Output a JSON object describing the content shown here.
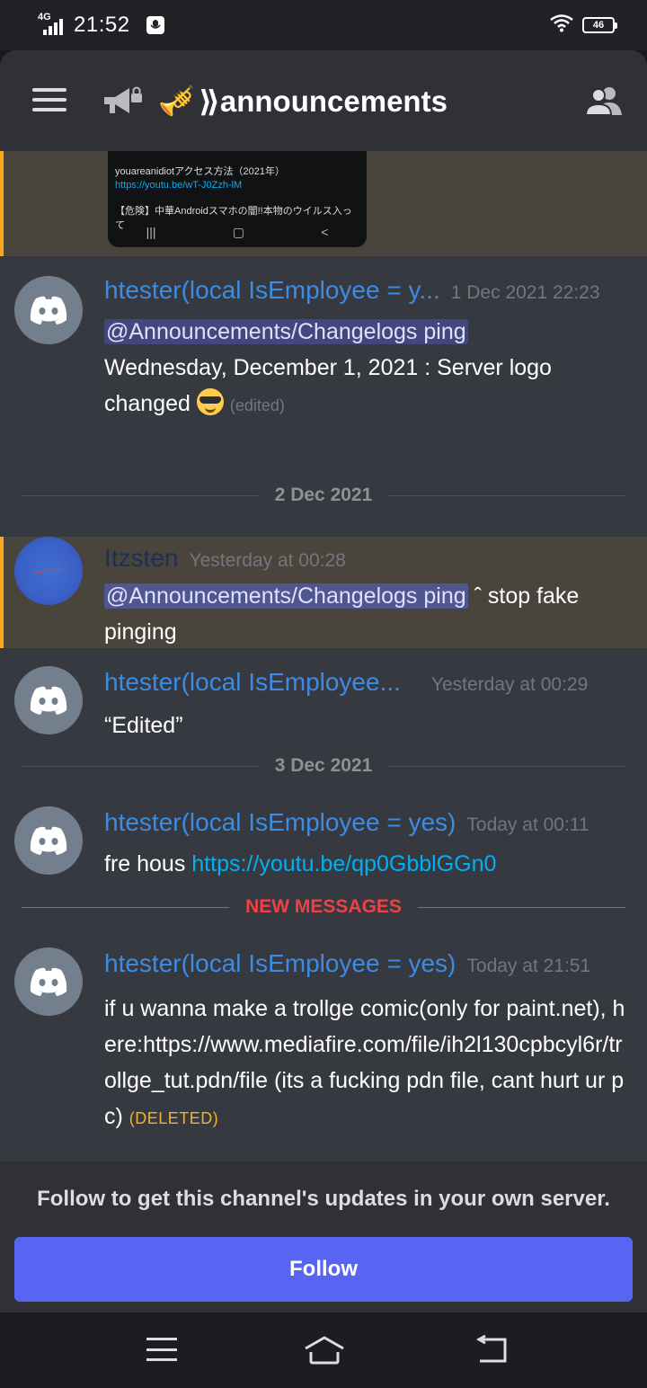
{
  "status_bar": {
    "network": "4G",
    "time": "21:52",
    "battery": "46"
  },
  "header": {
    "channel_emoji": "🎺",
    "channel_name": "⟫announcements"
  },
  "embed": {
    "line1": "youareanidiotアクセス方法（2021年）",
    "line2": "https://youtu.be/wT-J0Zzh-lM",
    "line3": "【危険】中華Androidスマホの闇!!本物のウイルス入って",
    "nav": [
      "|||",
      "▢",
      "<"
    ]
  },
  "messages": [
    {
      "author": "htester(local IsEmployee = y...",
      "timestamp": "1 Dec 2021 22:23",
      "mention": "@Announcements/Changelogs ping",
      "text": " Wednesday, December 1, 2021 : Server logo changed ",
      "edited": "(edited)"
    },
    {
      "author": "Itzsten",
      "timestamp": "Yesterday at 00:28",
      "mention": "@Announcements/Changelogs ping",
      "text": " ˆ stop fake pinging"
    },
    {
      "author": "htester(local IsEmployee...",
      "timestamp": "Yesterday at 00:29",
      "text": "“Edited”"
    },
    {
      "author": "htester(local IsEmployee = yes)",
      "timestamp": "Today at 00:11",
      "text": "fre hous ",
      "link": "https://youtu.be/qp0GbblGGn0"
    },
    {
      "author": "htester(local IsEmployee = yes)",
      "timestamp": "Today at 21:51",
      "text": "if u wanna make a trollge comic(only for paint.net), here:https://www.mediafire.com/file/ih2l130cpbcyl6r/trollge_tut.pdn/file (its a fucking pdn file, cant hurt ur pc) ",
      "deleted": "(DELETED)"
    }
  ],
  "dividers": {
    "d1": "2 Dec 2021",
    "d2": "3 Dec 2021",
    "new": "NEW MESSAGES"
  },
  "follow": {
    "text": "Follow to get this channel's updates in your own server.",
    "button": "Follow"
  },
  "colors": {
    "accent": "#5865f2",
    "mention_highlight": "#faa81a",
    "author": "#3d8be3",
    "link": "#00b0f4",
    "new_messages": "#ed4245"
  }
}
